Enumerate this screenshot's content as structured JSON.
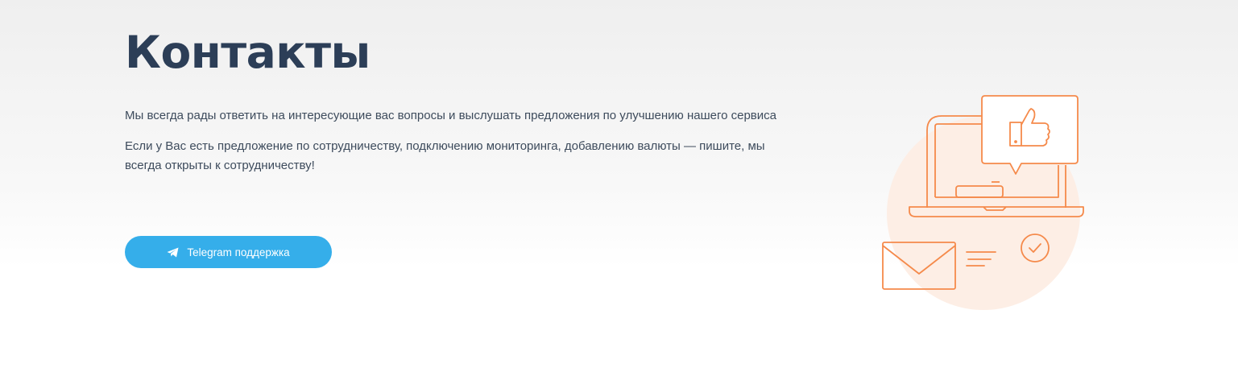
{
  "contacts": {
    "title": "Контакты",
    "paragraphs": [
      "Мы всегда рады ответить на интересующие вас вопросы и выслушать предложения по улучшению нашего сервиса",
      "Если у Вас есть предложение по сотрудничеству, подключению мониторинга, добавлению валюты — пишите, мы всегда открыты к сотрудничеству!"
    ],
    "telegram_button": {
      "label": "Telegram поддержка",
      "icon": "paper-plane-icon"
    },
    "illustration": {
      "icons": [
        "laptop-icon",
        "thumbs-up-icon",
        "envelope-icon",
        "check-circle-icon"
      ]
    }
  },
  "colors": {
    "title": "#2c3e57",
    "text": "#3d4b5c",
    "button": "#35aeea",
    "illustration_stroke": "#f58a4b",
    "illustration_circle": "#fdeee5"
  }
}
